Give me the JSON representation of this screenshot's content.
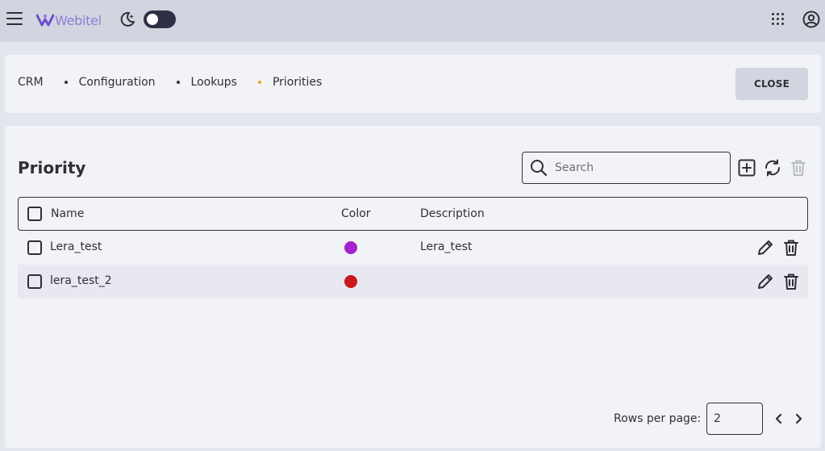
{
  "header": {
    "logo_text": "Webitel",
    "theme_toggle": "off",
    "accent_color": "#8c7fd6"
  },
  "breadcrumb": {
    "items": [
      "CRM",
      "Configuration",
      "Lookups",
      "Priorities"
    ],
    "active_dot_color": "#f4a01b"
  },
  "actions": {
    "close_label": "CLOSE"
  },
  "main": {
    "title": "Priority",
    "search": {
      "placeholder": "Search",
      "value": ""
    },
    "table": {
      "columns": [
        "Name",
        "Color",
        "Description"
      ],
      "rows": [
        {
          "name": "Lera_test",
          "color": "#a524c9",
          "description": "Lera_test"
        },
        {
          "name": "lera_test_2",
          "color": "#c8191c",
          "description": ""
        }
      ]
    },
    "pagination": {
      "rows_per_page_label": "Rows per page:",
      "rows_per_page": "2"
    }
  },
  "icons": {
    "menu": "hamburger-menu-icon",
    "theme": "moon-icon",
    "apps": "apps-grid-icon",
    "account": "account-icon",
    "search": "search-icon",
    "add": "add-square-icon",
    "refresh": "refresh-icon",
    "delete": "trash-icon",
    "edit": "pencil-icon",
    "prev": "chevron-left-icon",
    "next": "chevron-right-icon"
  }
}
